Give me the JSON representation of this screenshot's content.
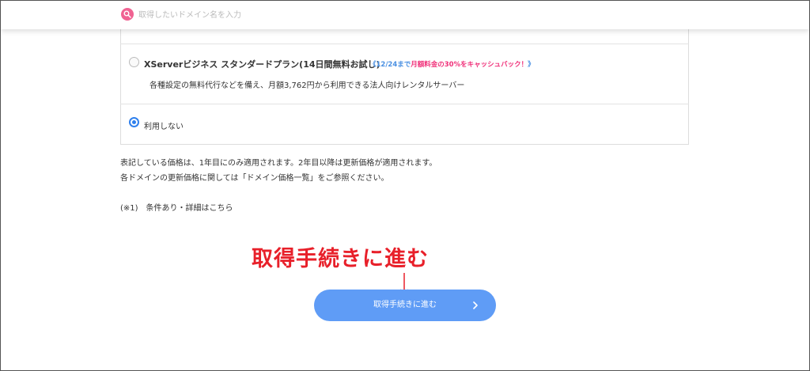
{
  "header": {
    "search_placeholder": "取得したいドメイン名を入力",
    "search_icon": "search-icon"
  },
  "plans": {
    "xserver_business": {
      "title": "XServerビジネス スタンダードプラン(14日間無料お試し)",
      "promo_prefix": "《12/24まで",
      "promo_highlight": "月額料金の30%をキャッシュバック！",
      "promo_suffix": "》",
      "description": "各種設定の無料代行などを備え、月額3,762円から利用できる法人向けレンタルサーバー",
      "selected": false
    },
    "no_use": {
      "label": "利用しない",
      "selected": true
    }
  },
  "notes": {
    "line1": "表記している価格は、1年目にのみ適用されます。2年目以降は更新価格が適用されます。",
    "line2": "各ドメインの更新価格に関しては「ドメイン価格一覧」をご参照ください。",
    "line3": "(※1)　条件あり・詳細はこちら"
  },
  "annotation": {
    "text": "取得手続きに進む",
    "color": "#e8202a"
  },
  "proceed_button": {
    "label": "取得手続きに進む",
    "color": "#5f9cf6",
    "icon": "chevron-right-icon"
  },
  "colors": {
    "accent_blue": "#2f80ed",
    "promo_blue": "#4a90e2",
    "promo_pink": "#f0317a",
    "search_icon_pink": "#f06292"
  }
}
